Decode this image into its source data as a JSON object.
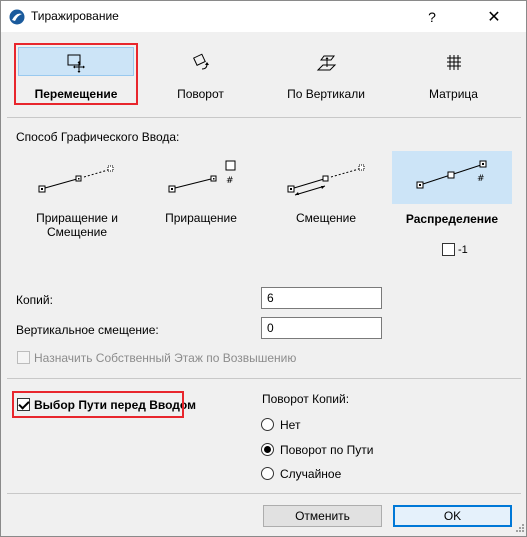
{
  "window": {
    "title": "Тиражирование",
    "help_label": "?",
    "close_label": "✕"
  },
  "tabs": [
    {
      "label": "Перемещение",
      "icon": "move-icon",
      "selected": true
    },
    {
      "label": "Поворот",
      "icon": "rotate-icon",
      "selected": false
    },
    {
      "label": "По Вертикали",
      "icon": "vertical-icon",
      "selected": false
    },
    {
      "label": "Матрица",
      "icon": "matrix-icon",
      "selected": false
    }
  ],
  "input_method": {
    "section_label": "Способ Графического Ввода:",
    "methods": [
      {
        "label": "Приращение и Смещение",
        "icon": "increment-offset-icon",
        "selected": false
      },
      {
        "label": "Приращение",
        "icon": "increment-icon",
        "selected": false
      },
      {
        "label": "Смещение",
        "icon": "offset-icon",
        "selected": false
      },
      {
        "label": "Распределение",
        "icon": "distribution-icon",
        "selected": true
      }
    ],
    "minus_one_label": "-1",
    "minus_one_checked": false
  },
  "fields": {
    "copies_label": "Копий:",
    "copies_value": "6",
    "vertical_offset_label": "Вертикальное смещение:",
    "vertical_offset_value": "0"
  },
  "assign_story": {
    "label": "Назначить Собственный Этаж по Возвышению",
    "checked": false,
    "disabled": true
  },
  "path_select": {
    "label": "Выбор Пути перед Вводом",
    "checked": true
  },
  "rotation": {
    "label": "Поворот Копий:",
    "options": [
      {
        "label": "Нет",
        "selected": false
      },
      {
        "label": "Поворот по Пути",
        "selected": true
      },
      {
        "label": "Случайное",
        "selected": false
      }
    ]
  },
  "buttons": {
    "cancel_label": "Отменить",
    "ok_label": "OK"
  },
  "colors": {
    "highlight_border": "#e8262d",
    "selection_fill": "#cce4f7",
    "default_button_border": "#0078d7"
  }
}
